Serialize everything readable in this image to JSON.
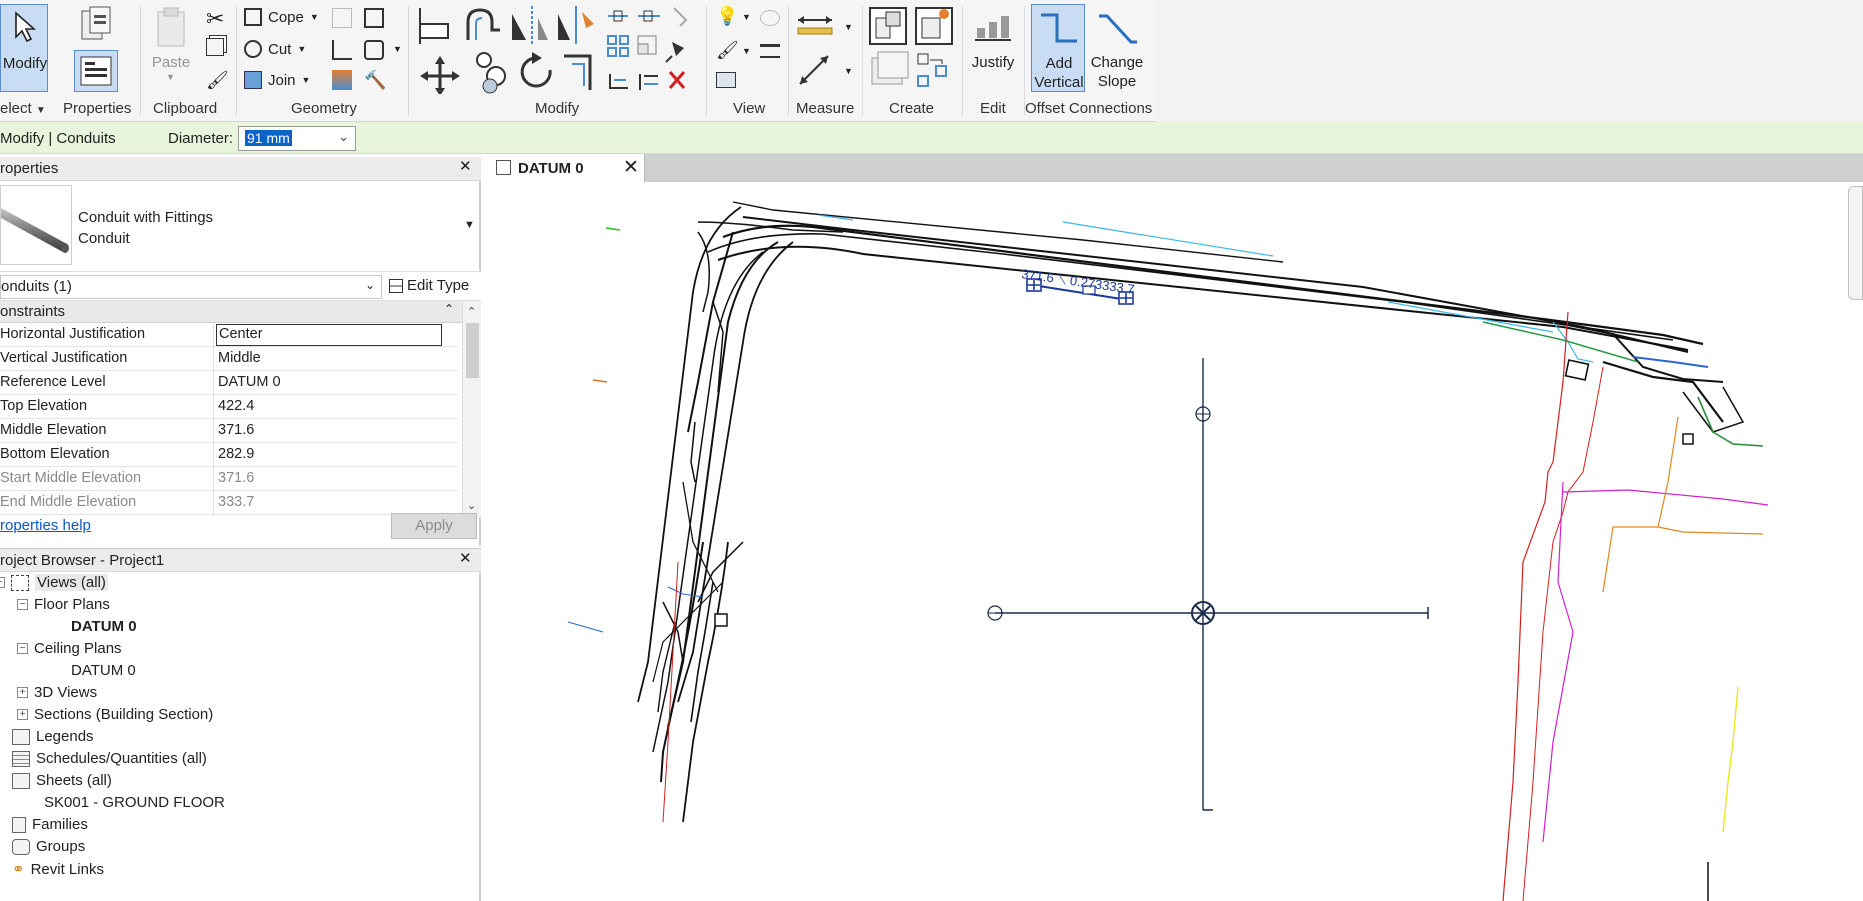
{
  "ribbon": {
    "modify_label": "Modify",
    "select_label": "elect",
    "properties_label": "Properties",
    "paste_label": "Paste",
    "clipboard_label": "Clipboard",
    "cope_label": "Cope",
    "cut_label": "Cut",
    "join_label": "Join",
    "geometry_label": "Geometry",
    "modify_panel_label": "Modify",
    "view_label": "View",
    "measure_label": "Measure",
    "create_label": "Create",
    "justify_label": "Justify",
    "edit_label": "Edit",
    "add_vertical_line1": "Add",
    "add_vertical_line2": "Vertical",
    "change_slope_line1": "Change",
    "change_slope_line2": "Slope",
    "offset_connections_label": "Offset Connections",
    "accent_color": "#c8dcf3"
  },
  "optbar": {
    "context": "Modify | Conduits",
    "diameter_label": "Diameter:",
    "diameter_value": "91 mm"
  },
  "properties": {
    "title": "roperties",
    "type_line1": "Conduit with Fittings",
    "type_line2": "Conduit",
    "instance_selector": "onduits (1)",
    "edit_type": "Edit Type",
    "group": "onstraints",
    "rows": [
      {
        "k": "Horizontal Justification",
        "v": "Center"
      },
      {
        "k": "Vertical Justification",
        "v": "Middle"
      },
      {
        "k": "Reference Level",
        "v": "DATUM 0"
      },
      {
        "k": "Top Elevation",
        "v": "422.4"
      },
      {
        "k": "Middle Elevation",
        "v": "371.6"
      },
      {
        "k": "Bottom Elevation",
        "v": "282.9"
      },
      {
        "k": "Start Middle Elevation",
        "v": "371.6"
      },
      {
        "k": "End Middle Elevation",
        "v": "333.7"
      }
    ],
    "help": "roperties help",
    "apply": "Apply"
  },
  "browser": {
    "title": "roject Browser - Project1",
    "items": [
      {
        "label": "Views (all)"
      },
      {
        "label": "Floor Plans"
      },
      {
        "label": "DATUM 0"
      },
      {
        "label": "Ceiling Plans"
      },
      {
        "label": "DATUM 0"
      },
      {
        "label": "3D Views"
      },
      {
        "label": "Sections (Building Section)"
      },
      {
        "label": "Legends"
      },
      {
        "label": "Schedules/Quantities (all)"
      },
      {
        "label": "Sheets (all)"
      },
      {
        "label": "SK001 - GROUND FLOOR"
      },
      {
        "label": "Families"
      },
      {
        "label": "Groups"
      },
      {
        "label": "Revit Links"
      }
    ]
  },
  "view": {
    "tab_label": "DATUM 0",
    "annotation": "371.6 ⟍ 0.273333.7"
  }
}
